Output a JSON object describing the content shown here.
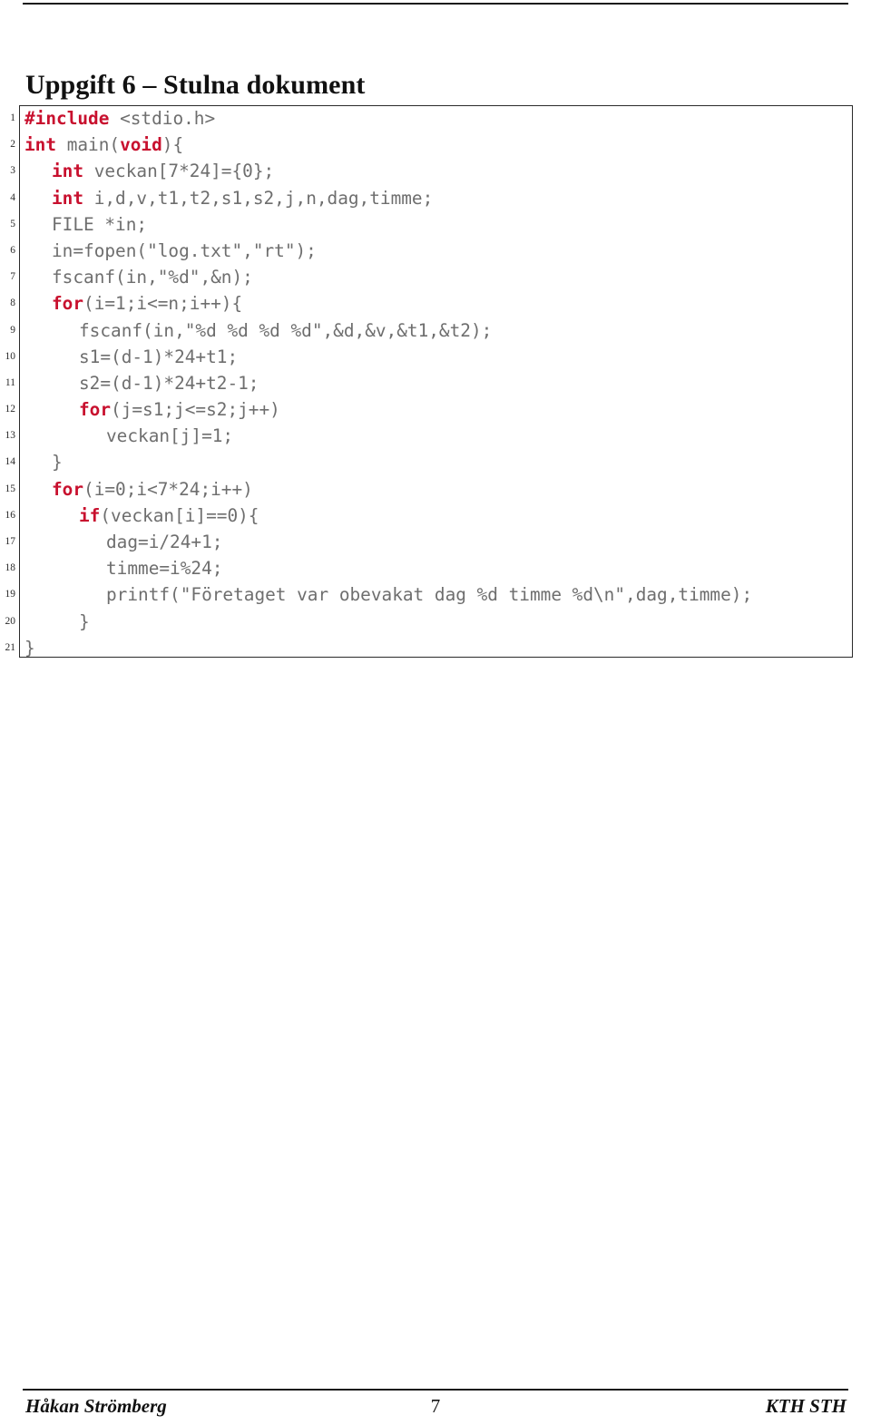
{
  "document": {
    "title": "Uppgift 6 – Stulna dokument",
    "page_number": "7",
    "footer_left": "Håkan Strömberg",
    "footer_right": "KTH STH"
  },
  "code_block": {
    "language": "c",
    "keyword_color": "#c8102e",
    "code_color": "#6e6e6e",
    "line_count": 21,
    "lines": [
      {
        "n": "1",
        "indent": 0,
        "segments": [
          {
            "t": "#include",
            "kw": true
          },
          {
            "t": " <stdio.h>",
            "kw": false
          }
        ]
      },
      {
        "n": "2",
        "indent": 0,
        "segments": [
          {
            "t": "int",
            "kw": true
          },
          {
            "t": " main(",
            "kw": false
          },
          {
            "t": "void",
            "kw": true
          },
          {
            "t": "){",
            "kw": false
          }
        ]
      },
      {
        "n": "3",
        "indent": 1,
        "segments": [
          {
            "t": "int",
            "kw": true
          },
          {
            "t": " veckan[7*24]={0};",
            "kw": false
          }
        ]
      },
      {
        "n": "4",
        "indent": 1,
        "segments": [
          {
            "t": "int",
            "kw": true
          },
          {
            "t": " i,d,v,t1,t2,s1,s2,j,n,dag,timme;",
            "kw": false
          }
        ]
      },
      {
        "n": "5",
        "indent": 1,
        "segments": [
          {
            "t": "FILE *in;",
            "kw": false
          }
        ]
      },
      {
        "n": "6",
        "indent": 1,
        "segments": [
          {
            "t": "in=fopen(\"log.txt\",\"rt\");",
            "kw": false
          }
        ]
      },
      {
        "n": "7",
        "indent": 1,
        "segments": [
          {
            "t": "fscanf(in,\"%d\",&n);",
            "kw": false
          }
        ]
      },
      {
        "n": "8",
        "indent": 1,
        "segments": [
          {
            "t": "for",
            "kw": true
          },
          {
            "t": "(i=1;i<=n;i++){",
            "kw": false
          }
        ]
      },
      {
        "n": "9",
        "indent": 2,
        "segments": [
          {
            "t": "fscanf(in,\"%d %d %d %d\",&d,&v,&t1,&t2);",
            "kw": false
          }
        ]
      },
      {
        "n": "10",
        "indent": 2,
        "segments": [
          {
            "t": "s1=(d-1)*24+t1;",
            "kw": false
          }
        ]
      },
      {
        "n": "11",
        "indent": 2,
        "segments": [
          {
            "t": "s2=(d-1)*24+t2-1;",
            "kw": false
          }
        ]
      },
      {
        "n": "12",
        "indent": 2,
        "segments": [
          {
            "t": "for",
            "kw": true
          },
          {
            "t": "(j=s1;j<=s2;j++)",
            "kw": false
          }
        ]
      },
      {
        "n": "13",
        "indent": 3,
        "segments": [
          {
            "t": "veckan[j]=1;",
            "kw": false
          }
        ]
      },
      {
        "n": "14",
        "indent": 1,
        "segments": [
          {
            "t": "}",
            "kw": false
          }
        ]
      },
      {
        "n": "15",
        "indent": 1,
        "segments": [
          {
            "t": "for",
            "kw": true
          },
          {
            "t": "(i=0;i<7*24;i++)",
            "kw": false
          }
        ]
      },
      {
        "n": "16",
        "indent": 2,
        "segments": [
          {
            "t": "if",
            "kw": true
          },
          {
            "t": "(veckan[i]==0){",
            "kw": false
          }
        ]
      },
      {
        "n": "17",
        "indent": 3,
        "segments": [
          {
            "t": "dag=i/24+1;",
            "kw": false
          }
        ]
      },
      {
        "n": "18",
        "indent": 3,
        "segments": [
          {
            "t": "timme=i%24;",
            "kw": false
          }
        ]
      },
      {
        "n": "19",
        "indent": 3,
        "segments": [
          {
            "t": "printf(\"Företaget var obevakat dag %d timme %d\\n\",dag,timme);",
            "kw": false
          }
        ]
      },
      {
        "n": "20",
        "indent": 2,
        "segments": [
          {
            "t": "}",
            "kw": false
          }
        ]
      },
      {
        "n": "21",
        "indent": 0,
        "segments": [
          {
            "t": "}",
            "kw": false
          }
        ]
      }
    ]
  }
}
